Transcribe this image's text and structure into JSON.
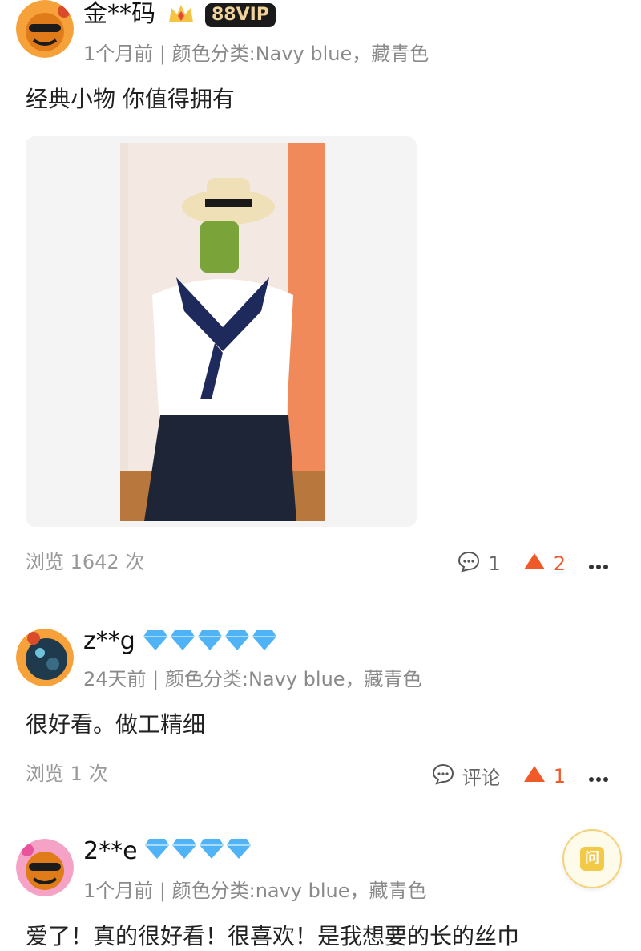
{
  "reviews": [
    {
      "username": "金**码",
      "vip_label": "88VIP",
      "meta": "1个月前 | 颜色分类:Navy blue，藏青色",
      "content": "经典小物 你值得拥有",
      "views": "浏览 1642 次",
      "comment_count": "1",
      "like_count": "2"
    },
    {
      "username": "z**g",
      "diamonds": 5,
      "meta": "24天前 | 颜色分类:Navy blue，藏青色",
      "content": "很好看。做工精细",
      "views": "浏览 1 次",
      "comment_label": "评论",
      "like_count": "1"
    },
    {
      "username": "2**e",
      "diamonds": 4,
      "meta": "1个月前 | 颜色分类:navy blue，藏青色",
      "content": "爱了！真的很好看！很喜欢！是我想要的长的丝巾"
    }
  ],
  "qa_button": {
    "label": "问"
  },
  "colors": {
    "accent": "#f05a28",
    "diamond": "#4fb3f6",
    "meta": "#8a8a8a",
    "vip_bg": "#1a1a1a",
    "vip_text": "#f2d29b"
  },
  "icons": [
    "crown-icon",
    "diamond-icon",
    "comment-icon",
    "thumb-up-icon",
    "more-icon",
    "question-icon"
  ]
}
